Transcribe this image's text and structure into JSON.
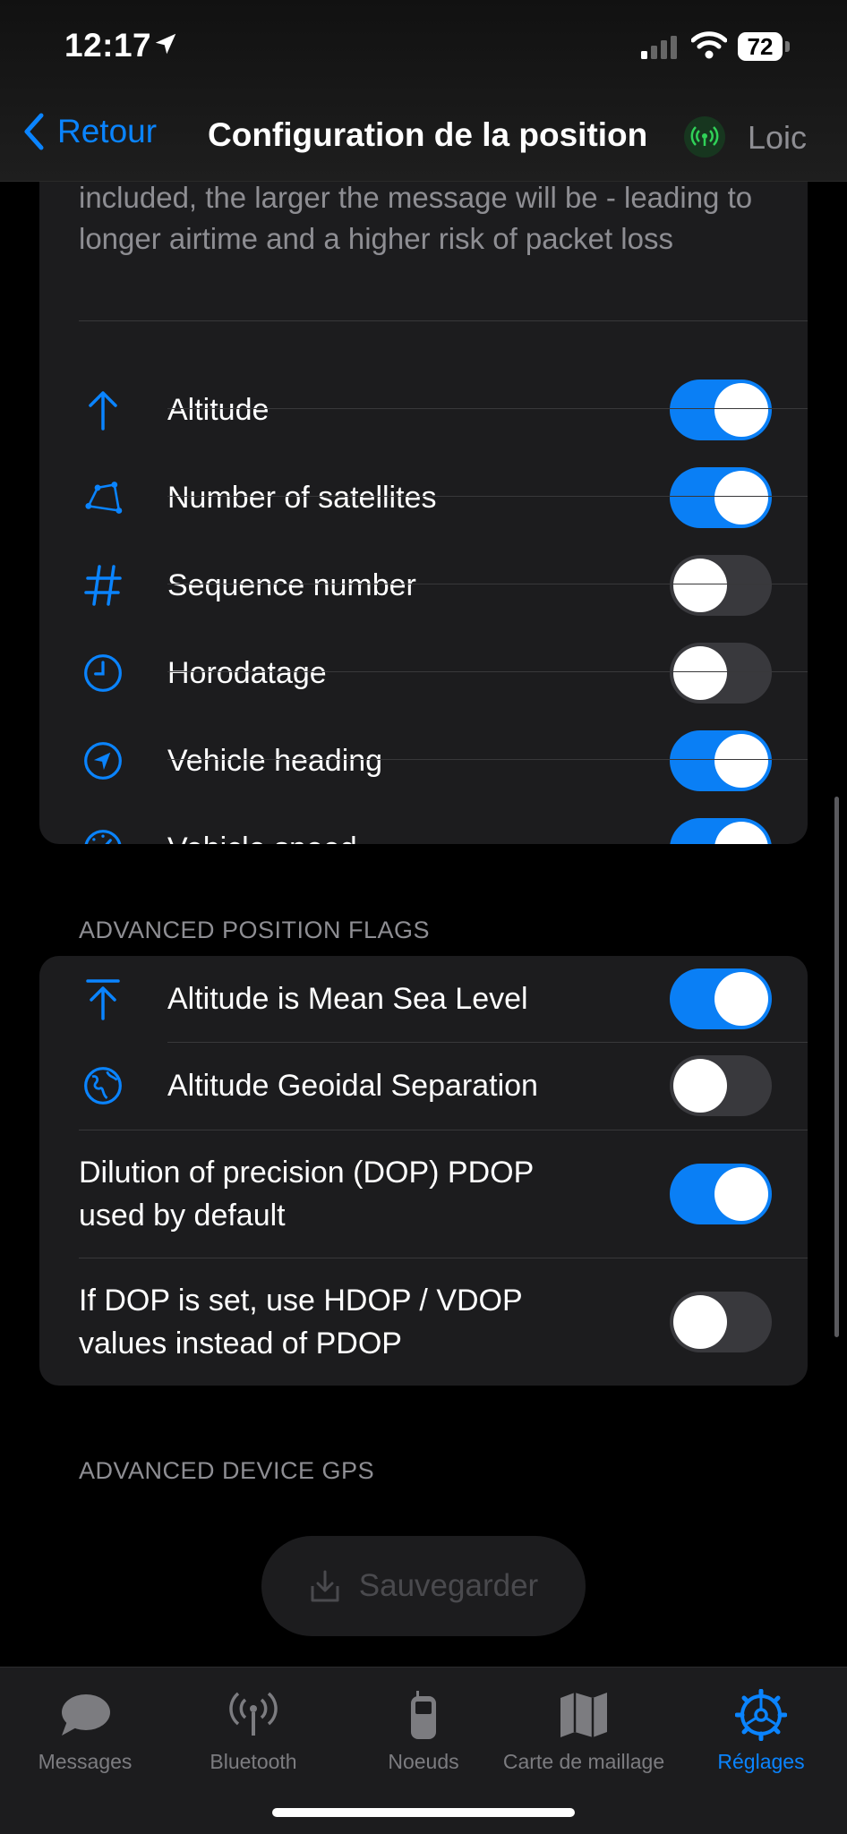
{
  "status_bar": {
    "time": "12:17",
    "battery": "72"
  },
  "nav": {
    "back_label": "Retour",
    "title": "Configuration de la position",
    "node_name": "Loic"
  },
  "position_card": {
    "description": "included, the larger the message will be - leading to longer airtime and a higher risk of packet loss",
    "items": [
      {
        "label": "Altitude",
        "icon": "arrow-up-icon",
        "enabled": true
      },
      {
        "label": "Number of satellites",
        "icon": "satellite-polygon-icon",
        "enabled": true
      },
      {
        "label": "Sequence number",
        "icon": "number-sign-icon",
        "enabled": false
      },
      {
        "label": "Horodatage",
        "icon": "clock-icon",
        "enabled": false
      },
      {
        "label": "Vehicle heading",
        "icon": "location-arrow-circle-icon",
        "enabled": true
      },
      {
        "label": "Vehicle speed",
        "icon": "speedometer-icon",
        "enabled": true
      }
    ]
  },
  "advanced_flags": {
    "header": "ADVANCED POSITION FLAGS",
    "items": [
      {
        "label": "Altitude is Mean Sea Level",
        "icon": "arrow-up-to-line-icon",
        "enabled": true
      },
      {
        "label": "Altitude Geoidal Separation",
        "icon": "globe-icon",
        "enabled": false
      },
      {
        "label": "Dilution of precision (DOP) PDOP used by default",
        "enabled": true
      },
      {
        "label": "If DOP is set, use HDOP / VDOP values instead of PDOP",
        "enabled": false
      }
    ]
  },
  "advanced_gps": {
    "header": "ADVANCED DEVICE GPS"
  },
  "save_button": {
    "label": "Sauvegarder"
  },
  "tabbar": {
    "tabs": [
      {
        "label": "Messages",
        "icon": "message-bubble-icon",
        "active": false
      },
      {
        "label": "Bluetooth",
        "icon": "antenna-icon",
        "active": false
      },
      {
        "label": "Noeuds",
        "icon": "radio-device-icon",
        "active": false
      },
      {
        "label": "Carte de maillage",
        "icon": "map-icon",
        "active": false
      },
      {
        "label": "Réglages",
        "icon": "gear-icon",
        "active": true
      }
    ]
  },
  "colors": {
    "accent": "#0a84ff",
    "toggle_on": "#0a7ff5",
    "card_bg": "#1c1c1e",
    "node_status": "#30d158"
  }
}
